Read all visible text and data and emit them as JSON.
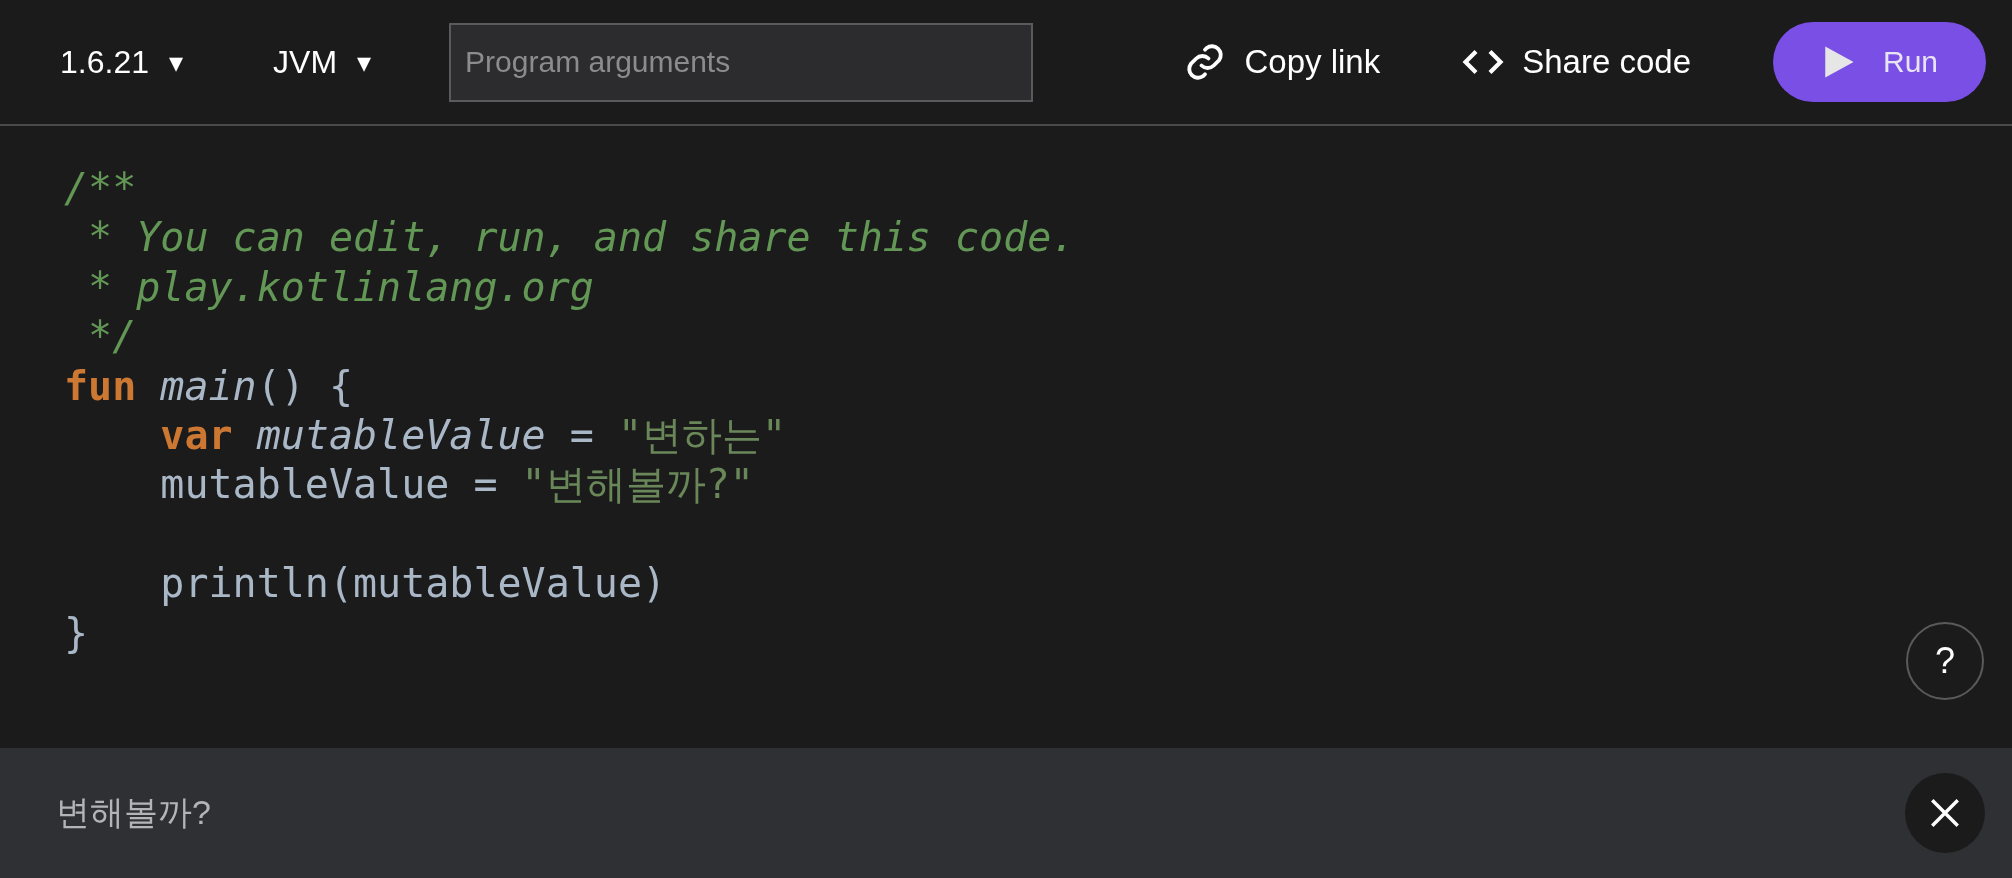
{
  "toolbar": {
    "version": {
      "label": "1.6.21",
      "caret": "▾"
    },
    "platform": {
      "label": "JVM",
      "caret": "▾"
    },
    "arguments": {
      "placeholder": "Program arguments"
    },
    "copy_link": {
      "label": "Copy link"
    },
    "share_code": {
      "label": "Share code"
    },
    "run": {
      "label": "Run"
    }
  },
  "editor": {
    "lines": [
      {
        "kind": "code",
        "tokens": [
          {
            "kind": "comment",
            "text": "/**"
          }
        ]
      },
      {
        "kind": "code",
        "tokens": [
          {
            "kind": "comment",
            "text": " * You can edit, run, and share this code."
          }
        ]
      },
      {
        "kind": "code",
        "tokens": [
          {
            "kind": "comment",
            "text": " * play.kotlinlang.org"
          }
        ]
      },
      {
        "kind": "code",
        "tokens": [
          {
            "kind": "comment",
            "text": " */"
          }
        ]
      },
      {
        "kind": "code",
        "tokens": [
          {
            "kind": "keyword",
            "text": "fun"
          },
          {
            "kind": "italic",
            "text": " main"
          },
          {
            "kind": "plain",
            "text": "() {"
          }
        ]
      },
      {
        "kind": "code",
        "tokens": [
          {
            "kind": "keyword",
            "text": "    var"
          },
          {
            "kind": "italic",
            "text": " mutableValue"
          },
          {
            "kind": "plain",
            "text": " = "
          },
          {
            "kind": "string",
            "text": "\"변하는\""
          }
        ]
      },
      {
        "kind": "code",
        "tokens": [
          {
            "kind": "plain",
            "text": "    mutableValue = "
          },
          {
            "kind": "string",
            "text": "\"변해볼까?\""
          }
        ]
      },
      {
        "kind": "blank"
      },
      {
        "kind": "code",
        "tokens": [
          {
            "kind": "plain",
            "text": "    println(mutableValue)"
          }
        ]
      },
      {
        "kind": "code",
        "tokens": [
          {
            "kind": "plain",
            "text": "}"
          }
        ]
      }
    ],
    "help": {
      "label": "?"
    }
  },
  "output": {
    "text": "변해볼까?"
  }
}
